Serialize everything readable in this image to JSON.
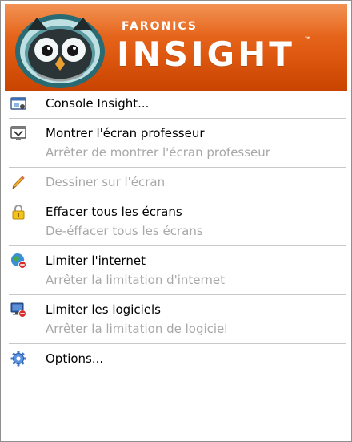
{
  "banner": {
    "brand_small": "FARONICS",
    "brand_name": "INSIGHT",
    "trademark": "™"
  },
  "menu": {
    "items": [
      {
        "label": "Console Insight...",
        "icon": "console-window-icon",
        "enabled": true
      },
      {
        "label": "Montrer l'écran professeur",
        "icon": "show-teacher-screen-icon",
        "enabled": true
      },
      {
        "label": "Arrêter de montrer l'écran professeur",
        "icon": "",
        "enabled": false
      },
      {
        "label": "Dessiner sur l'écran",
        "icon": "pencil-icon",
        "enabled": false
      },
      {
        "label": "Effacer tous les écrans",
        "icon": "padlock-icon",
        "enabled": true
      },
      {
        "label": "De-éffacer tous les écrans",
        "icon": "",
        "enabled": false
      },
      {
        "label": "Limiter l'internet",
        "icon": "globe-block-icon",
        "enabled": true
      },
      {
        "label": "Arrêter la limitation d'internet",
        "icon": "",
        "enabled": false
      },
      {
        "label": "Limiter les logiciels",
        "icon": "monitor-block-icon",
        "enabled": true
      },
      {
        "label": "Arrêter la limitation de logiciel",
        "icon": "",
        "enabled": false
      },
      {
        "label": "Options...",
        "icon": "gear-icon",
        "enabled": true
      }
    ]
  },
  "colors": {
    "banner_orange": "#e05a12",
    "disabled_text": "#a8a8a8",
    "separator": "#c8c8c8"
  }
}
